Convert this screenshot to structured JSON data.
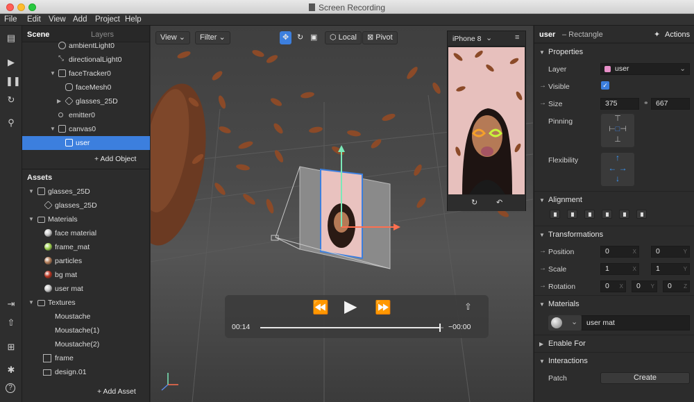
{
  "window": {
    "title": "Screen Recording"
  },
  "menu": [
    "File",
    "Edit",
    "View",
    "Add",
    "Project",
    "Help"
  ],
  "scene_panel": {
    "tabs": [
      "Scene",
      "Layers"
    ],
    "items": [
      {
        "label": "ambientLight0"
      },
      {
        "label": "directionalLight0"
      },
      {
        "label": "faceTracker0"
      },
      {
        "label": "faceMesh0"
      },
      {
        "label": "glasses_25D"
      },
      {
        "label": "emitter0"
      },
      {
        "label": "canvas0"
      },
      {
        "label": "user"
      }
    ],
    "add_object": "+ Add Object"
  },
  "assets_panel": {
    "title": "Assets",
    "items": [
      {
        "label": "glasses_25D"
      },
      {
        "label": "glasses_25D"
      },
      {
        "label": "Materials"
      },
      {
        "label": "face material",
        "color": "#c9c9c9"
      },
      {
        "label": "frame_mat",
        "color": "#9fd24e"
      },
      {
        "label": "particles",
        "color": "#b07a55"
      },
      {
        "label": "bg mat",
        "color": "#b8321f"
      },
      {
        "label": "user mat",
        "color": "#c9c9c9"
      },
      {
        "label": "Textures"
      },
      {
        "label": "Moustache"
      },
      {
        "label": "Moustache(1)"
      },
      {
        "label": "Moustache(2)"
      },
      {
        "label": "frame"
      },
      {
        "label": "design.01"
      }
    ],
    "add_asset": "+ Add Asset"
  },
  "viewport": {
    "view_label": "View",
    "filter_label": "Filter",
    "local_label": "Local",
    "pivot_label": "Pivot",
    "device": "iPhone 8"
  },
  "player": {
    "elapsed": "00:14",
    "remaining": "−00:00",
    "progress": 0.98
  },
  "properties": {
    "object_name": "user",
    "object_type": "– Rectangle",
    "actions_label": "Actions",
    "section_properties": "Properties",
    "layer_label": "Layer",
    "layer_value": "user",
    "layer_color": "#e78fc8",
    "visible_label": "Visible",
    "size_label": "Size",
    "size_w": "375",
    "size_h": "667",
    "pinning_label": "Pinning",
    "flexibility_label": "Flexibility",
    "section_alignment": "Alignment",
    "section_transformations": "Transformations",
    "position_label": "Position",
    "position": [
      "0",
      "0"
    ],
    "scale_label": "Scale",
    "scale": [
      "1",
      "1"
    ],
    "rotation_label": "Rotation",
    "rotation": [
      "0",
      "0",
      "0"
    ],
    "axis_x": "X",
    "axis_y": "Y",
    "axis_z": "Z",
    "section_materials": "Materials",
    "material_value": "user mat",
    "section_enable_for": "Enable For",
    "section_interactions": "Interactions",
    "patch_label": "Patch",
    "create_label": "Create"
  }
}
